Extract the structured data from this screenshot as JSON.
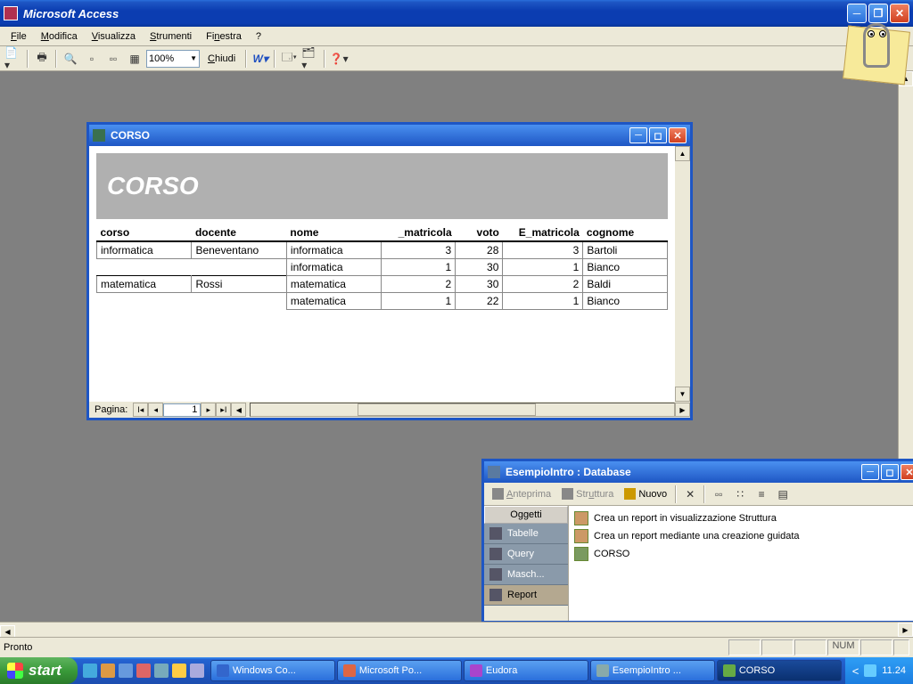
{
  "app": {
    "title": "Microsoft Access"
  },
  "menubar": {
    "file": "File",
    "modifica": "Modifica",
    "visualizza": "Visualizza",
    "strumenti": "Strumenti",
    "finestra": "Finestra",
    "help": "?"
  },
  "toolbar": {
    "zoom": "100%",
    "chiudi": "Chiudi"
  },
  "corso_window": {
    "title": "CORSO",
    "report_heading": "CORSO",
    "columns": [
      "corso",
      "docente",
      "nome",
      "_matricola",
      "voto",
      "E_matricola",
      "cognome"
    ],
    "groups": [
      {
        "corso": "informatica",
        "docente": "Beneventano",
        "rows": [
          {
            "nome": "informatica",
            "matricola": "3",
            "voto": "28",
            "e_matricola": "3",
            "cognome": "Bartoli"
          },
          {
            "nome": "informatica",
            "matricola": "1",
            "voto": "30",
            "e_matricola": "1",
            "cognome": "Bianco"
          }
        ]
      },
      {
        "corso": "matematica",
        "docente": "Rossi",
        "rows": [
          {
            "nome": "matematica",
            "matricola": "2",
            "voto": "30",
            "e_matricola": "2",
            "cognome": "Baldi"
          },
          {
            "nome": "matematica",
            "matricola": "1",
            "voto": "22",
            "e_matricola": "1",
            "cognome": "Bianco"
          }
        ]
      }
    ],
    "page_label": "Pagina:",
    "page_number": "1"
  },
  "db_window": {
    "title": "EsempioIntro : Database",
    "toolbar": {
      "anteprima": "Anteprima",
      "struttura": "Struttura",
      "nuovo": "Nuovo"
    },
    "sidebar": {
      "header": "Oggetti",
      "tabelle": "Tabelle",
      "query": "Query",
      "masch": "Masch...",
      "report": "Report"
    },
    "items": {
      "create_struct": "Crea un report in visualizzazione Struttura",
      "create_wizard": "Crea un report mediante una creazione guidata",
      "corso": "CORSO"
    }
  },
  "statusbar": {
    "ready": "Pronto",
    "num": "NUM"
  },
  "taskbar": {
    "start": "start",
    "tasks": {
      "windows": "Windows Co...",
      "powerpoint": "Microsoft Po...",
      "eudora": "Eudora",
      "esempio": "EsempioIntro ...",
      "corso": "CORSO"
    },
    "clock": "11.24"
  }
}
